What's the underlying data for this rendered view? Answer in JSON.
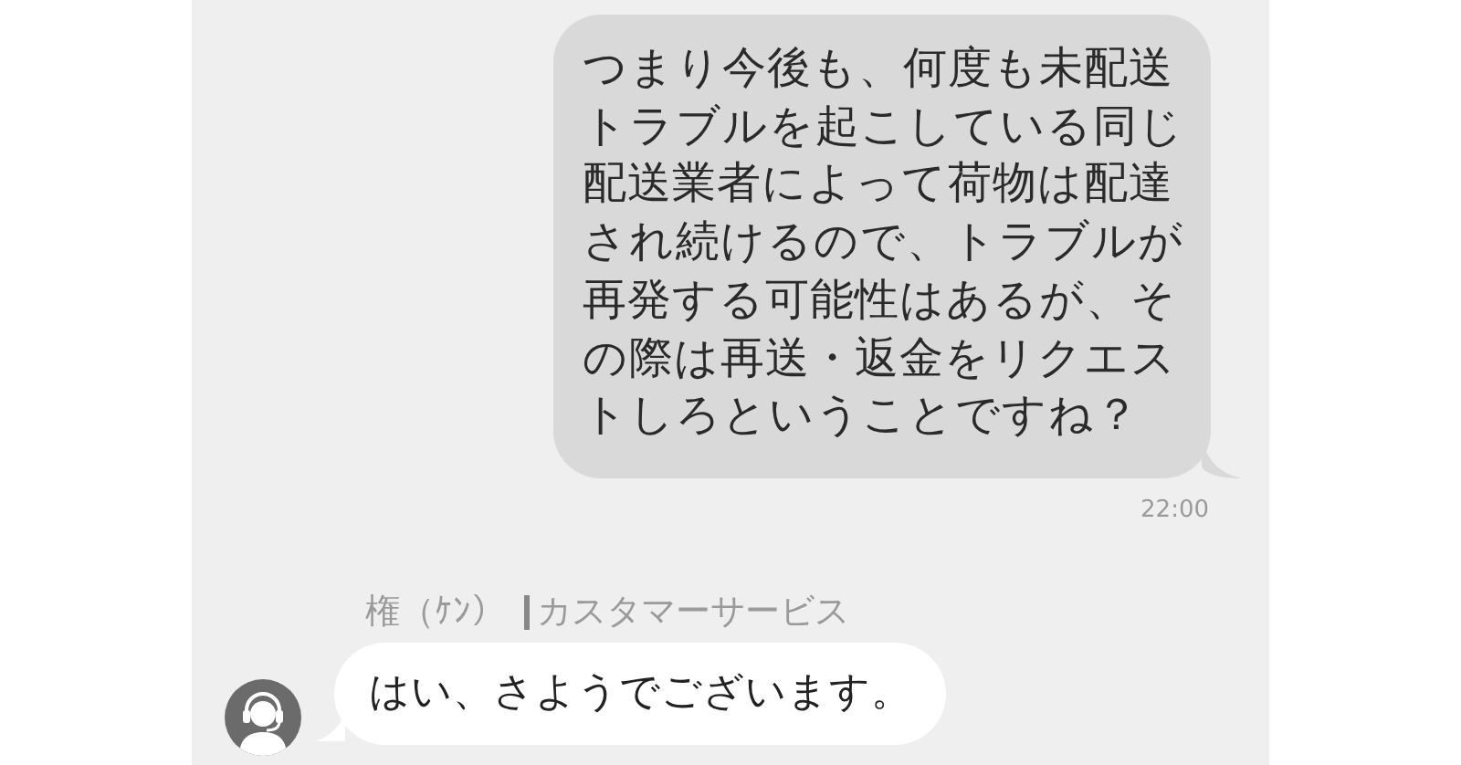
{
  "messages": [
    {
      "kind": "outgoing",
      "text": "つまり今後も、何度も未配送トラブルを起こしている同じ配送業者によって荷物は配達され続けるので、トラブルが再発する可能性はあるが、その際は再送・返金をリクエストしろということですね？",
      "time": "22:00"
    },
    {
      "kind": "incoming",
      "sender": "権（ｹﾝ）",
      "department": "カスタマーサービス",
      "text": "はい、さようでございます。"
    }
  ]
}
